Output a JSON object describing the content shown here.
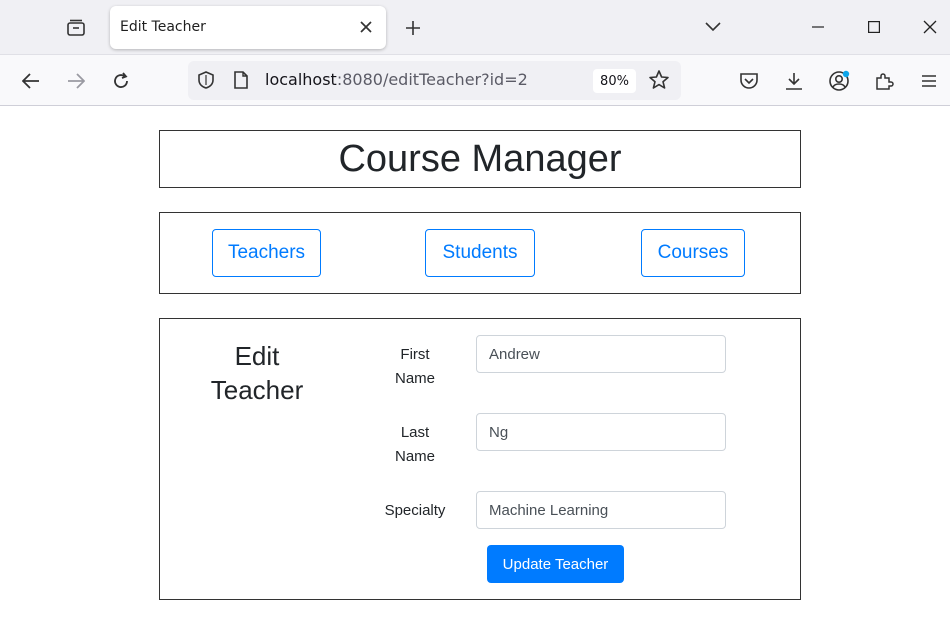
{
  "browser": {
    "tab_title": "Edit Teacher",
    "url_host": "localhost",
    "url_rest": ":8080/editTeacher?id=2",
    "zoom": "80%",
    "icons": [
      "tab-list-icon",
      "close-icon",
      "plus-icon",
      "chevron-down-icon",
      "minimize-icon",
      "maximize-icon",
      "window-close-icon",
      "back-icon",
      "forward-icon",
      "reload-icon",
      "shield-icon",
      "page-icon",
      "star-icon",
      "pocket-icon",
      "download-icon",
      "account-icon",
      "extensions-icon",
      "menu-icon"
    ]
  },
  "page": {
    "title": "Course Manager",
    "nav": {
      "teachers": "Teachers",
      "students": "Students",
      "courses": "Courses"
    },
    "form": {
      "heading_line1": "Edit",
      "heading_line2": "Teacher",
      "first_name_label_1": "First",
      "first_name_label_2": "Name",
      "first_name_value": "Andrew",
      "last_name_label_1": "Last",
      "last_name_label_2": "Name",
      "last_name_value": "Ng",
      "specialty_label": "Specialty",
      "specialty_value": "Machine Learning",
      "submit_label": "Update Teacher"
    }
  },
  "colors": {
    "primary": "#007bff",
    "text": "#212529",
    "border": "#333333"
  }
}
